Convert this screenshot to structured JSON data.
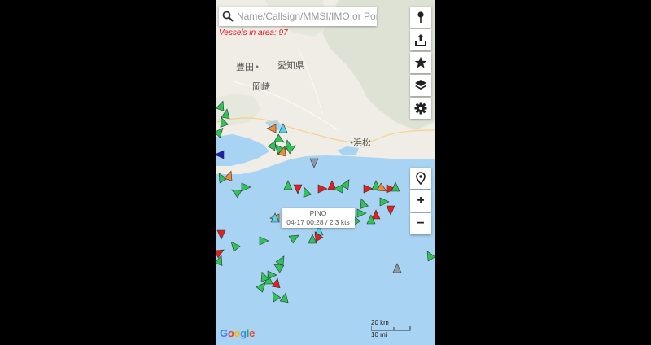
{
  "search": {
    "placeholder": "Name/Callsign/MMSI/IMO or Port"
  },
  "vessels_in_area": "Vessels in area: 97",
  "map_labels": {
    "toyota": "豊田",
    "aichi": "愛知県",
    "okazaki": "岡崎",
    "hamamatsu": "浜松"
  },
  "popup": {
    "name": "PINO",
    "info": "04-17 00:28 / 2.3 kts"
  },
  "toolbar": [
    {
      "name": "pin-icon"
    },
    {
      "name": "share-icon"
    },
    {
      "name": "star-icon"
    },
    {
      "name": "layers-icon"
    },
    {
      "name": "settings-icon"
    }
  ],
  "controls": {
    "locate": "location-icon",
    "zoom_in": "+",
    "zoom_out": "−"
  },
  "attribution": {
    "google": "Google"
  },
  "scale": {
    "km": "20 km",
    "mi": "10 mi"
  },
  "colors": {
    "sea": "#a9d3f3",
    "land": "#f1efe7",
    "cargo": "#2ec45a",
    "tanker": "#e3201b",
    "passenger": "#1e1eb4",
    "tug": "#ef8a36",
    "special": "#4fd8ec",
    "unknown": "#8d9aa6",
    "alert_text": "#e3121b"
  }
}
